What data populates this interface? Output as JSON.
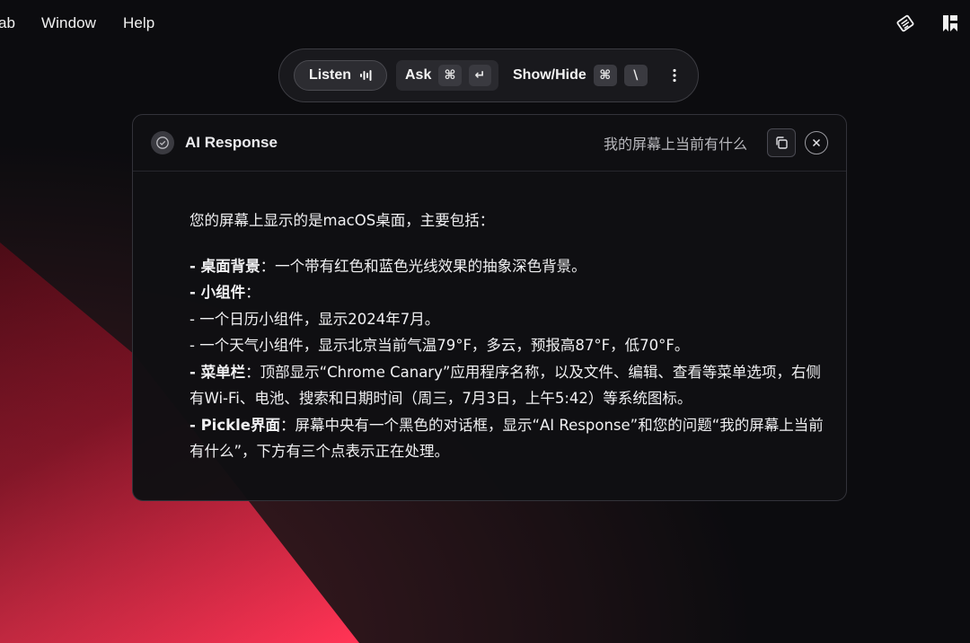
{
  "menubar": {
    "items": [
      "ab",
      "Window",
      "Help"
    ],
    "status_icons": [
      "script-editor-icon",
      "bookmark-icon"
    ]
  },
  "toolbar": {
    "listen_label": "Listen",
    "listen_icon": "audio-waveform-icon",
    "ask_label": "Ask",
    "ask_keys": [
      "⌘",
      "↵"
    ],
    "showhide_label": "Show/Hide",
    "showhide_keys": [
      "⌘",
      "\\"
    ],
    "more_icon": "vertical-ellipsis-icon"
  },
  "panel": {
    "title": "AI Response",
    "title_icon": "check-circle-icon",
    "question": "我的屏幕上当前有什么",
    "copy_icon": "copy-icon",
    "close_icon": "close-icon",
    "intro": "您的屏幕上显示的是macOS桌面，主要包括：",
    "items": [
      {
        "prefix": "- ",
        "bold": "桌面背景",
        "text": "：一个带有红色和蓝色光线效果的抽象深色背景。"
      },
      {
        "prefix": "- ",
        "bold": "小组件",
        "text": "："
      },
      {
        "prefix": "",
        "bold": "",
        "text": "- 一个日历小组件，显示2024年7月。"
      },
      {
        "prefix": "",
        "bold": "",
        "text": "- 一个天气小组件，显示北京当前气温79°F，多云，预报高87°F，低70°F。"
      },
      {
        "prefix": "- ",
        "bold": "菜单栏",
        "text": "：顶部显示“Chrome Canary”应用程序名称，以及文件、编辑、查看等菜单选项，右侧有Wi-Fi、电池、搜索和日期时间（周三，7月3日，上午5:42）等系统图标。"
      },
      {
        "prefix": "- ",
        "bold": "Pickle界面",
        "text": "：屏幕中央有一个黑色的对话框，显示“AI Response”和您的问题“我的屏幕上当前有什么”，下方有三个点表示正在处理。"
      }
    ]
  }
}
